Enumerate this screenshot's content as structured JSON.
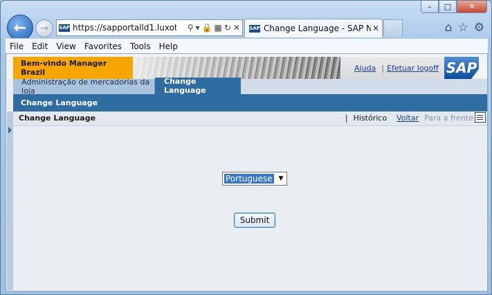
{
  "browser": {
    "address_url": "https://sapportalld1.luxot...",
    "address_favicon": "SAP",
    "tab_title": "Change Language - SAP Ne...",
    "tab_favicon": "SAP",
    "icons": [
      "back-arrow-icon",
      "forward-arrow-icon",
      "search-icon",
      "dropdown-icon",
      "lock-icon",
      "compat-icon",
      "refresh-icon",
      "close-icon",
      "home-icon",
      "star-icon",
      "gear-icon"
    ]
  },
  "menubar": {
    "items": [
      "File",
      "Edit",
      "View",
      "Favorites",
      "Tools",
      "Help"
    ]
  },
  "portal_header": {
    "welcome": "Bem-vindo Manager Brazil",
    "help_link": "Ajuda",
    "logoff_link": "Efetuar logoff",
    "logo_text": "SAP"
  },
  "tabs": [
    {
      "label": "Administração de mercadorias da loja"
    },
    {
      "label": "Change Language"
    }
  ],
  "subnav": {
    "label": "Change Language"
  },
  "page_header": {
    "title": "Change Language",
    "history": "Histórico",
    "back": "Voltar",
    "forward": "Para a frente"
  },
  "form": {
    "language_selected": "Portuguese",
    "submit_label": "Submit"
  },
  "colors": {
    "accent_orange": "#f7a600",
    "nav_blue": "#2e6ca2",
    "link_blue": "#1d3f91"
  }
}
